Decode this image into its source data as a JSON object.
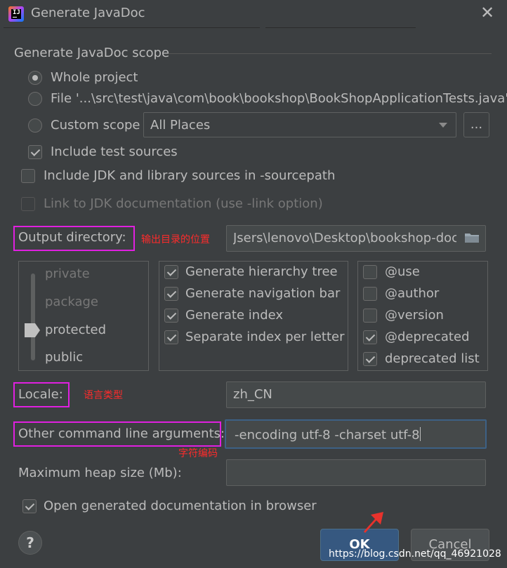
{
  "window": {
    "title": "Generate JavaDoc",
    "app_icon": "intellij-icon",
    "close_icon": "close-icon"
  },
  "scope": {
    "group_title": "Generate JavaDoc scope",
    "options": [
      {
        "label": "Whole project",
        "checked": true
      },
      {
        "label": "File '...\\src\\test\\java\\com\\book\\bookshop\\BookShopApplicationTests.java'",
        "checked": false
      },
      {
        "label": "Custom scope",
        "checked": false
      }
    ],
    "custom_scope_value": "All Places",
    "browse_label": "...",
    "include_test_sources": {
      "label": "Include test sources",
      "checked": true
    }
  },
  "options": {
    "include_jdk": {
      "label": "Include JDK and library sources in -sourcepath",
      "checked": false
    },
    "link_jdk": {
      "label": "Link to JDK documentation (use -link option)",
      "checked": false,
      "disabled": true
    }
  },
  "output": {
    "label": "Output directory:",
    "annotation": "输出目录的位置",
    "value": "Jsers\\lenovo\\Desktop\\bookshop-doc",
    "folder_icon": "folder-icon"
  },
  "visibility": {
    "levels": [
      "private",
      "package",
      "protected",
      "public"
    ],
    "selected": "protected"
  },
  "generate": [
    {
      "label": "Generate hierarchy tree",
      "checked": true
    },
    {
      "label": "Generate navigation bar",
      "checked": true
    },
    {
      "label": "Generate index",
      "checked": true
    },
    {
      "label": "Separate index per letter",
      "checked": true
    }
  ],
  "tags": [
    {
      "label": "@use",
      "checked": false
    },
    {
      "label": "@author",
      "checked": false
    },
    {
      "label": "@version",
      "checked": false
    },
    {
      "label": "@deprecated",
      "checked": true
    },
    {
      "label": "deprecated list",
      "checked": true
    }
  ],
  "locale": {
    "label": "Locale:",
    "annotation": "语言类型",
    "value": "zh_CN"
  },
  "cmd_args": {
    "label": "Other command line arguments:",
    "annotation": "字符编码",
    "value": "-encoding utf-8 -charset utf-8"
  },
  "heap": {
    "label": "Maximum heap size (Mb):",
    "value": ""
  },
  "open_browser": {
    "label": "Open generated documentation in browser",
    "checked": true
  },
  "buttons": {
    "help": "?",
    "ok": "OK",
    "cancel": "Cancel"
  },
  "watermark": "https://blog.csdn.net/qq_46921028",
  "colors": {
    "background": "#3c3f41",
    "highlight": "#e020e0",
    "annotation": "#ff2b2b",
    "ok_button": "#365880"
  }
}
